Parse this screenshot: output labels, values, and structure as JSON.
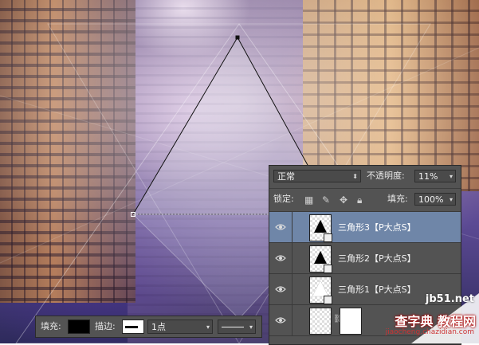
{
  "layers_panel": {
    "blend_mode": "正常",
    "opacity_label": "不透明度:",
    "opacity_value": "11%",
    "lock_label": "锁定:",
    "fill_label": "填充:",
    "fill_value": "100%",
    "selected_color": "#6f86a8",
    "layers": [
      {
        "name": "三角形3【P大点S】",
        "visible": true,
        "selected": true
      },
      {
        "name": "三角形2【P大点S】",
        "visible": true,
        "selected": false
      },
      {
        "name": "三角形1【P大点S】",
        "visible": true,
        "selected": false
      },
      {
        "name": "",
        "visible": true,
        "selected": false
      }
    ]
  },
  "options_bar": {
    "fill_label": "填充:",
    "fill_color": "#000000",
    "stroke_label": "描边:",
    "stroke_width": "1点"
  },
  "watermark": {
    "line1": "jb51.net",
    "line2": "查字典 教程网",
    "line3": "jiaocheng.chazidian.com"
  }
}
